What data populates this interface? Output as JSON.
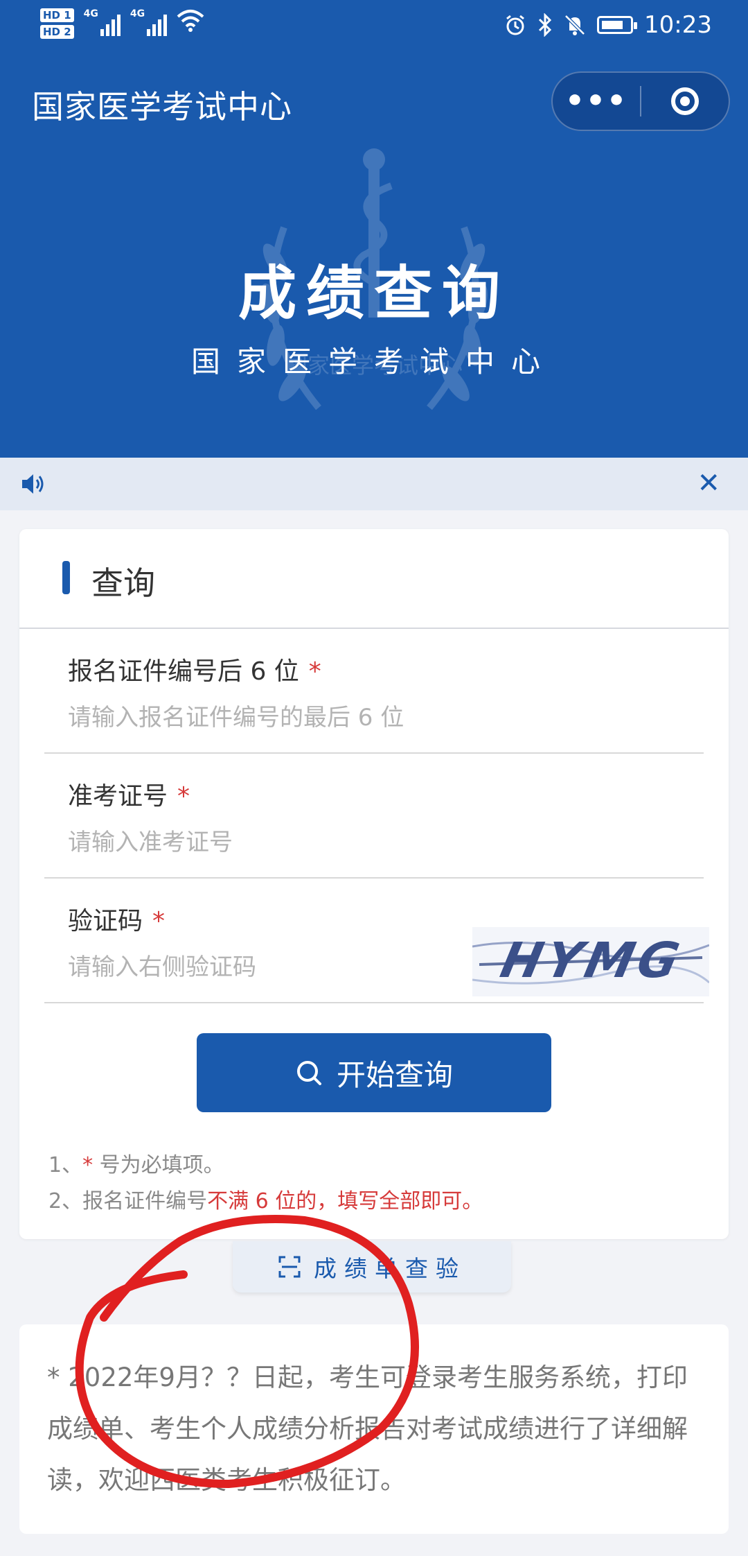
{
  "status_bar": {
    "hd_labels": [
      "HD 1",
      "HD 2"
    ],
    "network_labels": [
      "4G",
      "4G"
    ],
    "time": "10:23"
  },
  "nav": {
    "title": "国家医学考试中心",
    "more_label": "•••"
  },
  "hero": {
    "title": "成绩查询",
    "subtitle": "国家医学考试中心",
    "emblem_text": "国家医学考试中心"
  },
  "notice_bar": {
    "close_label": "✕"
  },
  "form": {
    "section_title": "查询",
    "fields": [
      {
        "label": "报名证件编号后 6 位",
        "required_mark": "*",
        "placeholder": "请输入报名证件编号的最后 6 位",
        "value": ""
      },
      {
        "label": "准考证号",
        "required_mark": "*",
        "placeholder": "请输入准考证号",
        "value": ""
      },
      {
        "label": "验证码",
        "required_mark": "*",
        "placeholder": "请输入右侧验证码",
        "value": ""
      }
    ],
    "captcha_text": "HYMG",
    "submit_label": "开始查询",
    "notes": {
      "note1_prefix": "1、",
      "note1_star": "*",
      "note1_suffix": " 号为必填项。",
      "note2_prefix": "2、报名证件编号",
      "note2_highlight": "不满 6 位的，填写全部即可。"
    }
  },
  "verify": {
    "label": "成绩单查验"
  },
  "info": {
    "text": "* 2022年9月？？日起，考生可登录考生服务系统，打印成绩单、考生个人成绩分析报告对考试成绩进行了详细解读，欢迎西医类考生积极征订。"
  },
  "colors": {
    "brand_blue": "#1a5aad",
    "required_red": "#d63a3a",
    "annotation_red": "#e02020",
    "page_background": "#f2f3f7"
  },
  "icons": [
    "volume-icon",
    "close-icon",
    "more-icon",
    "target-icon",
    "search-icon",
    "scan-icon",
    "alarm-icon",
    "bluetooth-icon",
    "mute-icon",
    "battery-icon",
    "wifi-icon"
  ]
}
